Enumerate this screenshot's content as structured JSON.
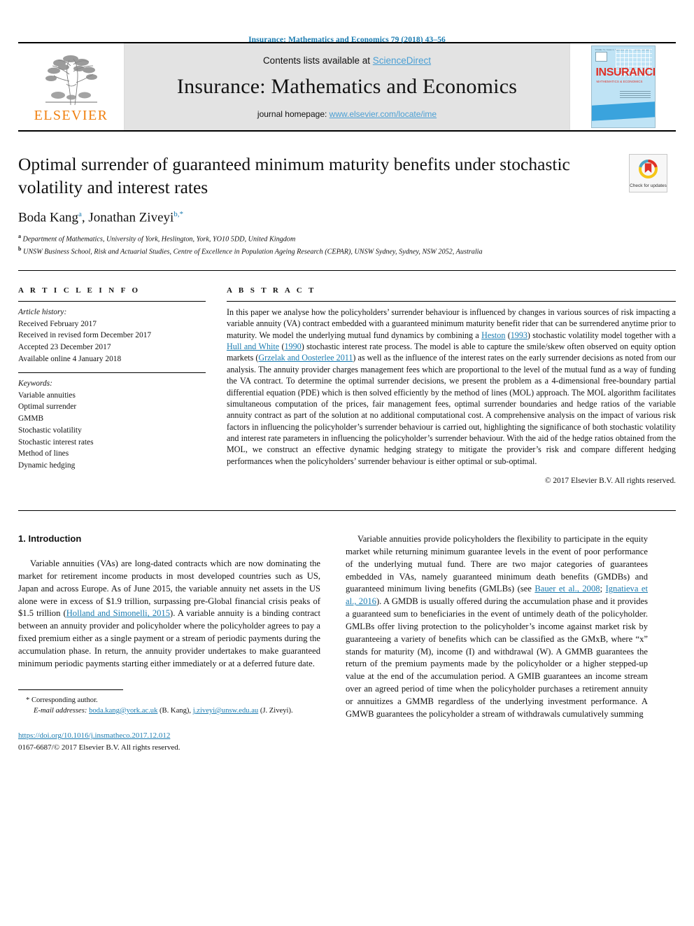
{
  "running_head": "Insurance: Mathematics and Economics 79 (2018) 43–56",
  "banner": {
    "publisher_name": "ELSEVIER",
    "contents_prefix": "Contents lists available at ",
    "contents_link": "ScienceDirect",
    "journal_title": "Insurance: Mathematics and Economics",
    "homepage_prefix": "journal homepage: ",
    "homepage_link": "www.elsevier.com/locate/ime",
    "cover": {
      "title": "INSURANCE",
      "subtitle": "MATHEMATICS & ECONOMICS",
      "masthead_left": "Volume 51, Issue 2, September 2012",
      "masthead_right": "ISSN 0167-6687"
    }
  },
  "article": {
    "title": "Optimal surrender of guaranteed minimum maturity benefits under stochastic volatility and interest rates",
    "crossmark_label": "Check for updates",
    "authors_plain": "Boda Kang",
    "author2_plain": ", Jonathan Ziveyi",
    "author1_sup": "a",
    "author2_sup": "b,*",
    "affiliation_a_sup": "a",
    "affiliation_a": " Department of Mathematics, University of York, Heslington, York, YO10 5DD, United Kingdom",
    "affiliation_b_sup": "b",
    "affiliation_b": " UNSW Business School, Risk and Actuarial Studies, Centre of Excellence in Population Ageing Research (CEPAR), UNSW Sydney, Sydney, NSW 2052, Australia"
  },
  "info": {
    "heading": "A R T I C L E   I N F O",
    "history_label": "Article history:",
    "history": [
      "Received February 2017",
      "Received in revised form December 2017",
      "Accepted 23 December 2017",
      "Available online 4 January 2018"
    ],
    "keywords_label": "Keywords:",
    "keywords": [
      "Variable annuities",
      "Optimal surrender",
      "GMMB",
      "Stochastic volatility",
      "Stochastic interest rates",
      "Method of lines",
      "Dynamic hedging"
    ]
  },
  "abstract": {
    "heading": "A B S T R A C T",
    "p1": "In this paper we analyse how the policyholders’ surrender behaviour is influenced by changes in various sources of risk impacting a variable annuity (VA) contract embedded with a guaranteed minimum maturity benefit rider that can be surrendered anytime prior to maturity. We model the underlying mutual fund dynamics by combining a ",
    "ref1": "Heston",
    "p2": " (",
    "ref1b": "1993",
    "p3": ") stochastic volatility model together with a ",
    "ref2": "Hull and White",
    "p4": " (",
    "ref2b": "1990",
    "p5": ") stochastic interest rate process. The model is able to capture the smile/skew often observed on equity option markets (",
    "ref3": "Grzelak and Oosterlee 2011",
    "p6": ") as well as the influence of the interest rates on the early surrender decisions as noted from our analysis. The annuity provider charges management fees which are proportional to the level of the mutual fund as a way of funding the VA contract. To determine the optimal surrender decisions, we present the problem as a 4-dimensional free-boundary partial differential equation (PDE) which is then solved efficiently by the method of lines (MOL) approach. The MOL algorithm facilitates simultaneous computation of the prices, fair management fees, optimal surrender boundaries and hedge ratios of the variable annuity contract as part of the solution at no additional computational cost. A comprehensive analysis on the impact of various risk factors in influencing the policyholder’s surrender behaviour is carried out, highlighting the significance of both stochastic volatility and interest rate parameters in influencing the policyholder’s surrender behaviour. With the aid of the hedge ratios obtained from the MOL, we construct an effective dynamic hedging strategy to mitigate the provider’s risk and compare different hedging performances when the policyholders’ surrender behaviour is either optimal or sub-optimal.",
    "copyright": "© 2017 Elsevier B.V. All rights reserved."
  },
  "body": {
    "section_heading": "1.  Introduction",
    "left_p1_a": "Variable annuities (VAs) are long-dated contracts which are now  dominating the market for retirement income products in most developed countries such as US, Japan and across Europe. As of June 2015, the variable annuity net assets in the US alone were in excess of $1.9 trillion, surpassing pre-Global financial crisis peaks of $1.5 trillion (",
    "left_ref1": "Holland and Simonelli, 2015",
    "left_p1_b": "). A variable annuity is a binding contract between an annuity provider and policyholder where the policyholder agrees to pay a fixed premium either as a single payment or a stream of periodic payments during the accumulation phase. In return, the annuity provider undertakes to make guaranteed minimum periodic payments starting either immediately or at a deferred future date.",
    "right_p1_a": "Variable annuities provide policyholders the flexibility to participate in the equity market while returning minimum guarantee levels in the event of poor performance of the underlying mutual fund. There are two major categories of guarantees embedded in VAs, namely guaranteed minimum death benefits (GMDBs) and guaranteed minimum living benefits (GMLBs) (see ",
    "right_ref1": "Bauer et al., 2008",
    "right_p1_b": "; ",
    "right_ref2": "Ignatieva et al., 2016",
    "right_p1_c": "). A GMDB is usually offered during the accumulation phase and it provides a guaranteed sum to beneficiaries in the event of untimely death of the policyholder. GMLBs offer living protection to the policyholder’s income against market risk by guaranteeing a variety of benefits which can be classified as the GMxB, where “x” stands for maturity (M), income (I) and withdrawal (W). A GMMB guarantees the return of the premium payments made by the policyholder or a higher stepped-up value at the end of the accumulation period. A GMIB guarantees an income stream over an agreed period of time when the policyholder purchases a retirement annuity or annuitizes a GMMB regardless of the underlying investment performance. A GMWB guarantees the policyholder a stream of withdrawals cumulatively summing"
  },
  "footnotes": {
    "corresponding": "*  Corresponding author.",
    "email_label": "E-mail addresses:",
    "email1": "boda.kang@york.ac.uk",
    "email1_owner": " (B. Kang), ",
    "email2": "j.ziveyi@unsw.edu.au",
    "email2_owner": " (J. Ziveyi).",
    "doi": "https://doi.org/10.1016/j.insmatheco.2017.12.012",
    "issn": "0167-6687/© 2017 Elsevier B.V. All rights reserved."
  },
  "colors": {
    "link_blue": "#1a7bb0",
    "elsevier_orange": "#f08010",
    "banner_grey": "#e3e3e3",
    "cover_blue": "#bfe3f5",
    "crossmark_red": "#e03127"
  }
}
